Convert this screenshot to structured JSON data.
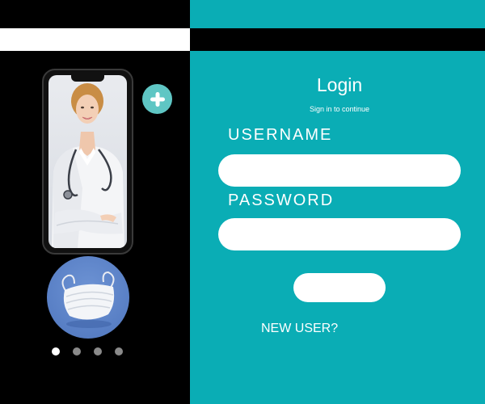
{
  "login": {
    "title": "Login",
    "subtitle": "Sign in to continue",
    "username_label": "USERNAME",
    "username_value": "",
    "password_label": "PASSWORD",
    "password_value": "",
    "submit_label": "",
    "new_user_label": "NEW USER?"
  },
  "carousel": {
    "slide_count": 4,
    "active_index": 0
  },
  "colors": {
    "teal": "#0aadb5",
    "plus_button": "#5fc6c4",
    "mask_circle": "#5b82c8",
    "black": "#000000",
    "white": "#ffffff"
  },
  "icons": {
    "plus": "plus-icon",
    "phone_photo": "doctor-photo",
    "mask": "face-mask-image"
  }
}
